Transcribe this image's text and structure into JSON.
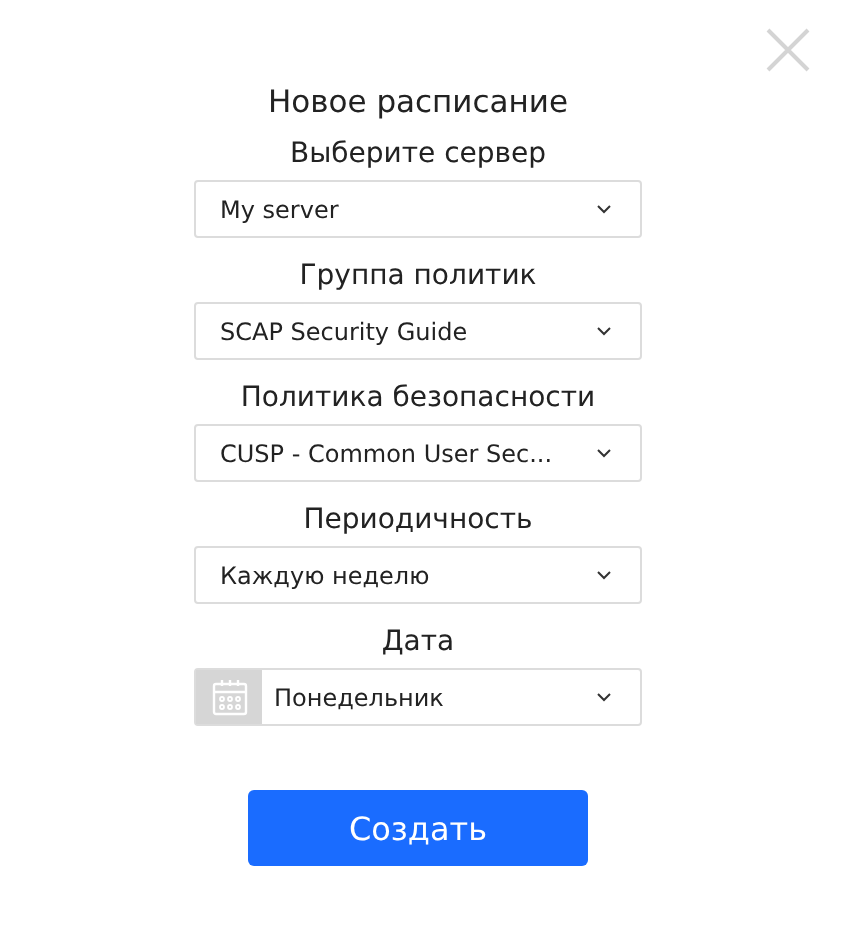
{
  "dialog": {
    "title": "Новое расписание",
    "fields": [
      {
        "kind": "select",
        "label": "Выберите сервер",
        "value": "My server"
      },
      {
        "kind": "select",
        "label": "Группа политик",
        "value": "SCAP Security Guide"
      },
      {
        "kind": "select",
        "label": "Политика безопасности",
        "value": "CUSP - Common User Sec..."
      },
      {
        "kind": "select",
        "label": "Периодичность",
        "value": "Каждую неделю"
      },
      {
        "kind": "date",
        "label": "Дата",
        "value": "Понедельник"
      }
    ],
    "submit": "Создать"
  }
}
